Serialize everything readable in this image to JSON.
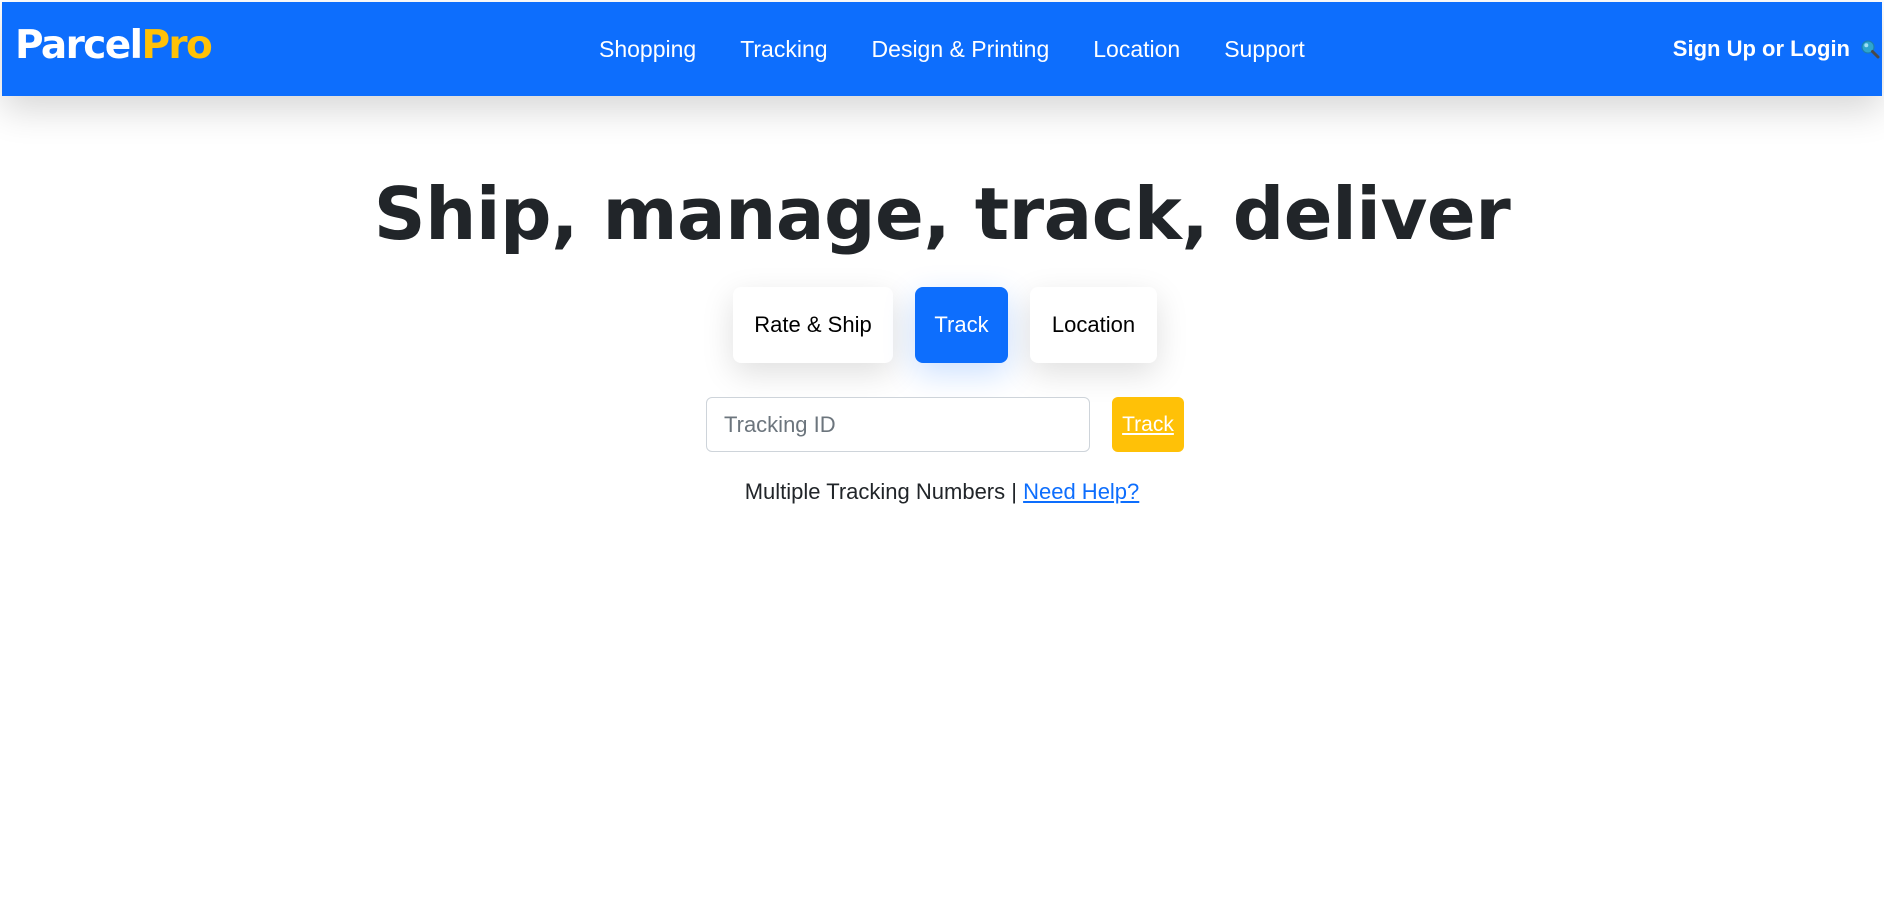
{
  "navbar": {
    "brand_main": "Parcel",
    "brand_accent": "Pro",
    "links": [
      "Shopping",
      "Tracking",
      "Design & Printing",
      "Location",
      "Support"
    ],
    "signup_label": "Sign Up or Login",
    "search_icon": "search-icon"
  },
  "hero": {
    "title": "Ship, manage, track, deliver",
    "tabs": [
      {
        "label": "Rate & Ship",
        "active": false
      },
      {
        "label": "Track",
        "active": true
      },
      {
        "label": "Location",
        "active": false
      }
    ]
  },
  "track_form": {
    "placeholder": "Tracking ID",
    "value": "",
    "button_label": "Track"
  },
  "help": {
    "text": "Multiple Tracking Numbers",
    "separator": " | ",
    "link_label": "Need Help?"
  },
  "colors": {
    "primary": "#0d6efd",
    "accent": "#ffc107",
    "heading": "#212529"
  }
}
